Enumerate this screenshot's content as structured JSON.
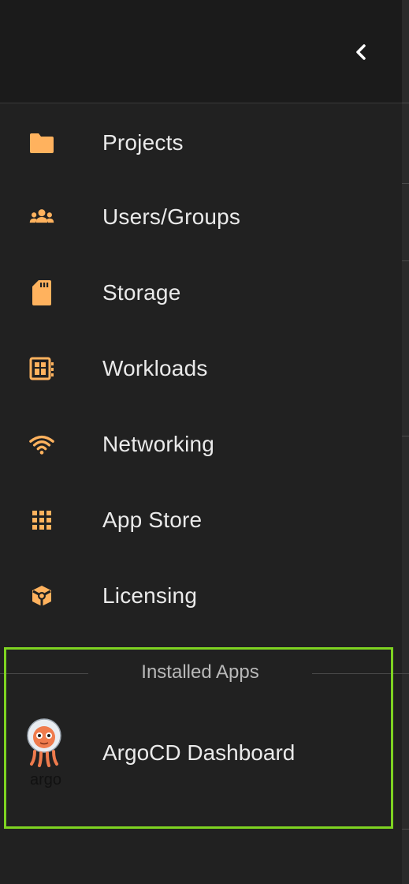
{
  "colors": {
    "accent": "#ffb25e",
    "highlight_border": "#7ed321",
    "background": "#212121",
    "text": "#eaeaea",
    "muted_text": "#b9b9b9"
  },
  "header": {
    "collapse_icon": "chevron-left-icon"
  },
  "nav": {
    "items": [
      {
        "label": "Projects",
        "icon": "folder-icon"
      },
      {
        "label": "Users/Groups",
        "icon": "users-icon"
      },
      {
        "label": "Storage",
        "icon": "sd-card-icon"
      },
      {
        "label": "Workloads",
        "icon": "workloads-icon"
      },
      {
        "label": "Networking",
        "icon": "wifi-icon"
      },
      {
        "label": "App Store",
        "icon": "grid-icon"
      },
      {
        "label": "Licensing",
        "icon": "license-icon"
      }
    ]
  },
  "installed_apps": {
    "title": "Installed Apps",
    "items": [
      {
        "label": "ArgoCD Dashboard",
        "icon": "argo-logo-icon",
        "logo_text": "argo"
      }
    ]
  }
}
